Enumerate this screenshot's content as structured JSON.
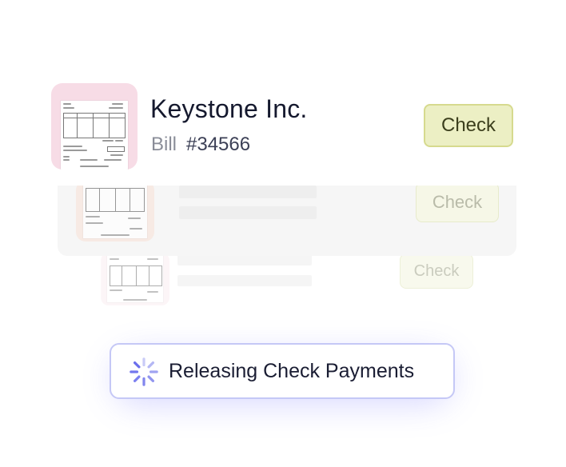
{
  "bill_item": {
    "company": "Keystone Inc.",
    "bill_label": "Bill",
    "bill_number": "#34566",
    "action_label": "Check",
    "thumb_bg": "#f7dce6",
    "action_bg": "#ecefc4"
  },
  "queued_items": [
    {
      "action_label": "Check"
    },
    {
      "action_label": "Check"
    }
  ],
  "status": {
    "text": "Releasing Check Payments",
    "icon": "spinner-icon",
    "accent": "#7b7ff0"
  }
}
